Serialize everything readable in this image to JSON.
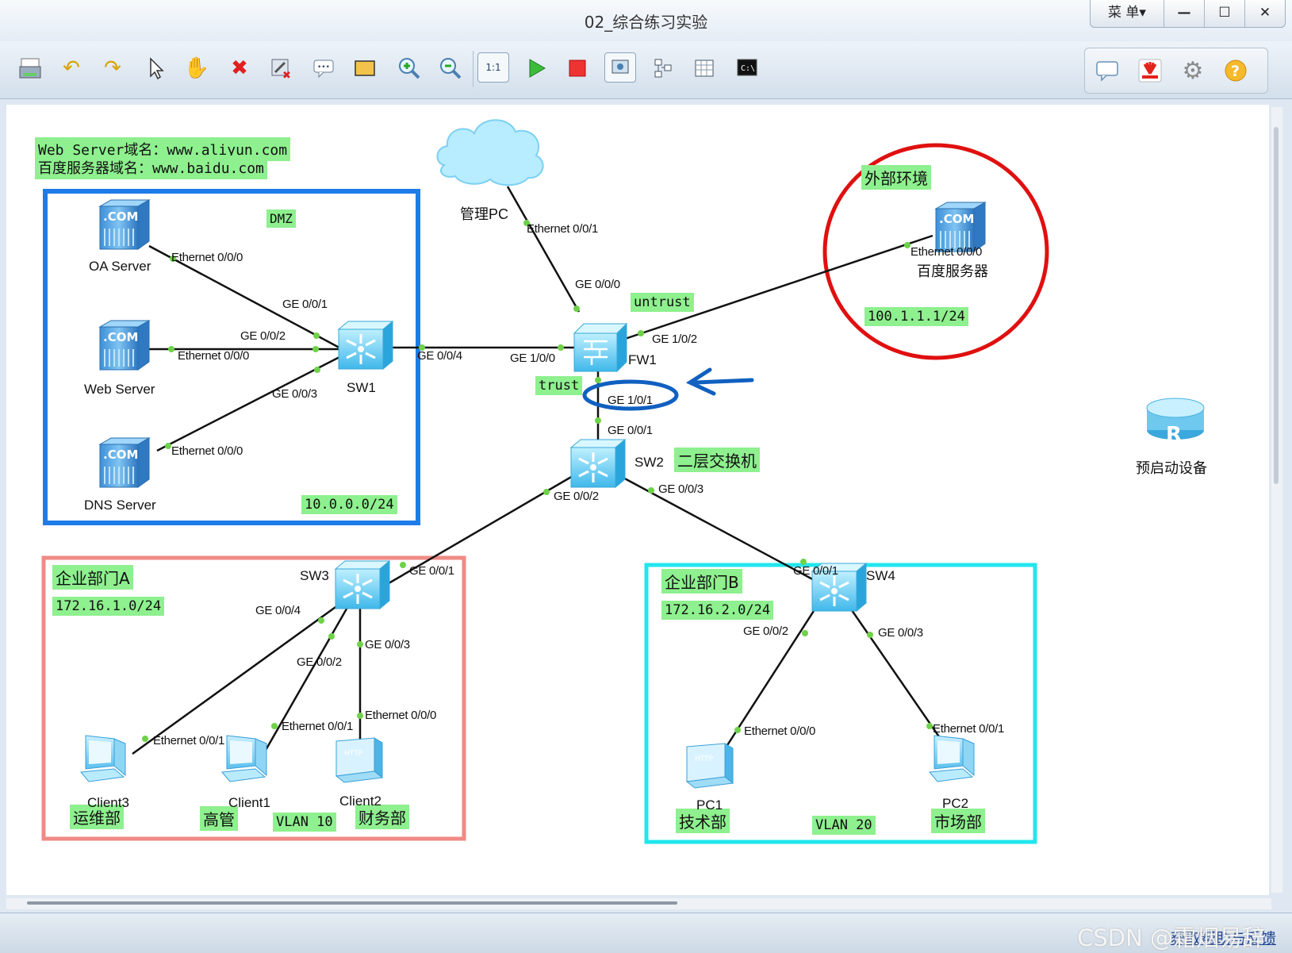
{
  "window": {
    "title": "02_综合练习实验",
    "menu_label": "菜 单▾",
    "minimize": "—",
    "maximize": "☐",
    "close": "✕"
  },
  "toolbar": {
    "icons": [
      "print-icon",
      "undo-icon",
      "redo-icon",
      "pointer-icon",
      "hand-icon",
      "delete-icon",
      "erase-link-icon",
      "text-note-icon",
      "rectangle-icon",
      "zoom-in-icon",
      "zoom-out-icon",
      "fit-1to1-icon",
      "start-icon",
      "stop-icon",
      "capture-icon",
      "topology-icon",
      "grid-icon",
      "console-icon"
    ],
    "right_icons": [
      "chat-icon",
      "huawei-logo-icon",
      "settings-icon",
      "help-icon"
    ]
  },
  "annotations": {
    "domain_line1": "Web Server域名：www.aliyun.com",
    "domain_line2": "百度服务器域名：www.baidu.com",
    "dmz": "DMZ",
    "dmz_subnet": "10.0.0.0/24",
    "external_env": "外部环境",
    "external_ip": "100.1.1.1/24",
    "untrust": "untrust",
    "trust": "trust",
    "l2_switch": "二层交换机",
    "deptA": "企业部门A",
    "deptA_subnet": "172.16.1.0/24",
    "deptB": "企业部门B",
    "deptB_subnet": "172.16.2.0/24",
    "ops": "运维部",
    "mgmt": "高管",
    "vlan10": "VLAN 10",
    "finance": "财务部",
    "tech": "技术部",
    "vlan20": "VLAN 20",
    "market": "市场部"
  },
  "devices": {
    "oa_server": "OA Server",
    "web_server": "Web Server",
    "dns_server": "DNS Server",
    "sw1": "SW1",
    "cloud": "管理PC",
    "fw1": "FW1",
    "baidu": "百度服务器",
    "sw2": "SW2",
    "sw3": "SW3",
    "sw4": "SW4",
    "client3": "Client3",
    "client1": "Client1",
    "client2": "Client2",
    "pc1": "PC1",
    "pc2": "PC2",
    "preboot": "预启动设备"
  },
  "ports": {
    "oa_eth": "Ethernet 0/0/0",
    "sw1_g1": "GE 0/0/1",
    "sw1_g2": "GE 0/0/2",
    "web_eth": "Ethernet 0/0/0",
    "sw1_g3": "GE 0/0/3",
    "dns_eth": "Ethernet 0/0/0",
    "sw1_g4": "GE 0/0/4",
    "fw_g100": "GE 1/0/0",
    "cloud_eth": "Ethernet 0/0/1",
    "fw_g000": "GE 0/0/0",
    "fw_g102": "GE 1/0/2",
    "baidu_eth": "Ethernet 0/0/0",
    "fw_g101": "GE 1/0/1",
    "sw2_g1": "GE 0/0/1",
    "sw2_g2": "GE 0/0/2",
    "sw2_g3": "GE 0/0/3",
    "sw3_g1": "GE 0/0/1",
    "sw3_g4": "GE 0/0/4",
    "sw3_g2": "GE 0/0/2",
    "sw3_g3": "GE 0/0/3",
    "c3_eth": "Ethernet 0/0/1",
    "c1_eth": "Ethernet 0/0/1",
    "c2_eth": "Ethernet 0/0/0",
    "sw4_g1": "GE 0/0/1",
    "sw4_g2": "GE 0/0/2",
    "sw4_g3": "GE 0/0/3",
    "pc1_eth": "Ethernet 0/0/0",
    "pc2_eth": "Ethernet 0/0/1"
  },
  "statusbar": {
    "link": "获取帮助与反馈",
    "watermark": "CSDN @霜烟易辞"
  },
  "colors": {
    "dmz_box": "#1e7ce8",
    "deptA_box": "#f08a86",
    "deptB_box": "#22e6ee",
    "external_circle": "#e01010",
    "label_bg": "#8ef08e",
    "annotation_blue": "#1060c0"
  }
}
